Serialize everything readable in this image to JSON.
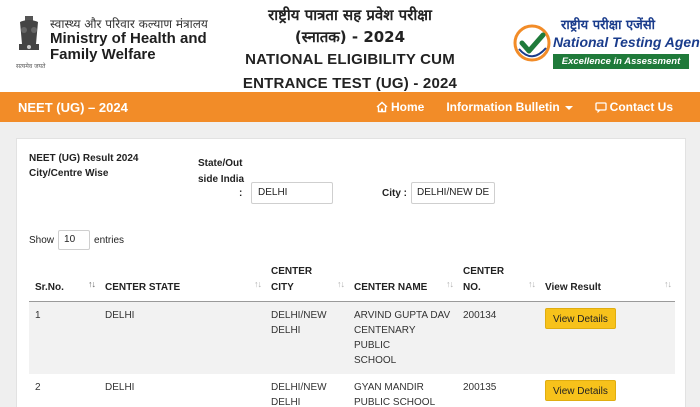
{
  "header": {
    "ministry_hindi": "स्वास्थ्य और परिवार कल्याण मंत्रालय",
    "ministry_line1": "Ministry of Health and",
    "ministry_line2": "Family Welfare",
    "emblem_caption": "सत्यमेव जयते",
    "title_hindi_1": "राष्ट्रीय पात्रता सह प्रवेश परीक्षा",
    "title_hindi_2": "(स्नातक) - 2024",
    "title_en_1": "NATIONAL ELIGIBILITY CUM",
    "title_en_2": "ENTRANCE TEST (UG) - 2024",
    "nta_hindi": "राष्ट्रीय परीक्षा एजेंसी",
    "nta_en": "National Testing Agency",
    "nta_tagline": "Excellence in Assessment"
  },
  "navbar": {
    "brand": "NEET (UG) – 2024",
    "home": "Home",
    "info": "Information Bulletin",
    "contact": "Contact Us"
  },
  "filters": {
    "title_1": "NEET (UG) Result 2024",
    "title_2": "City/Centre Wise",
    "state_label_1": "State/Out",
    "state_label_2": "side India",
    "state_colon": ":",
    "state_value": "DELHI",
    "city_label": "City :",
    "city_value": "DELHI/NEW DE"
  },
  "table_controls": {
    "show": "Show",
    "entries_value": "10",
    "entries": "entries"
  },
  "table": {
    "headers": {
      "srno": "Sr.No.",
      "state": "CENTER STATE",
      "city_1": "CENTER",
      "city_2": "CITY",
      "name": "CENTER NAME",
      "no_1": "CENTER",
      "no_2": "NO.",
      "view": "View Result"
    },
    "sort_glyph": "↑↓",
    "rows": [
      {
        "srno": "1",
        "state": "DELHI",
        "city_1": "DELHI/NEW",
        "city_2": "DELHI",
        "name_1": "ARVIND GUPTA DAV",
        "name_2": "CENTENARY PUBLIC",
        "name_3": "SCHOOL",
        "no": "200134",
        "button": "View Details"
      },
      {
        "srno": "2",
        "state": "DELHI",
        "city_1": "DELHI/NEW",
        "city_2": "DELHI",
        "name_1": "GYAN MANDIR",
        "name_2": "PUBLIC SCHOOL",
        "no": "200135",
        "button": "View Details"
      }
    ]
  },
  "colors": {
    "navbar": "#f28c28",
    "button": "#f7c21b",
    "nta_blue": "#1a3c8c",
    "nta_green": "#1f7a3a"
  }
}
